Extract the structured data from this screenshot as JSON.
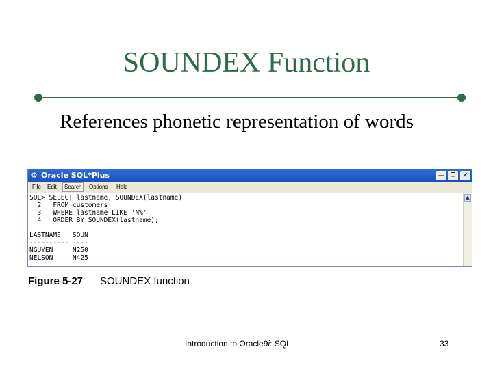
{
  "slide": {
    "title": "SOUNDEX Function",
    "bullet": "References phonetic representation of words"
  },
  "window": {
    "title": "Oracle SQL*Plus",
    "menu": [
      "File",
      "Edit",
      "Search",
      "Options",
      "Help"
    ],
    "console_lines": [
      "SQL> SELECT lastname, SOUNDEX(lastname)",
      "  2   FROM customers",
      "  3   WHERE lastname LIKE 'N%'",
      "  4   ORDER BY SOUNDEX(lastname);",
      "",
      "LASTNAME   SOUN",
      "---------- ----",
      "NGUYEN     N250",
      "NELSON     N425"
    ]
  },
  "figure": {
    "number": "Figure 5-27",
    "caption": "SOUNDEX function"
  },
  "footer": {
    "prefix": "Introduction to Oracle9",
    "italic": "i",
    "suffix": ": SQL",
    "page": "33"
  },
  "colors": {
    "title_green": "#2e6b4a",
    "titlebar_blue": "#2f6ad8"
  }
}
